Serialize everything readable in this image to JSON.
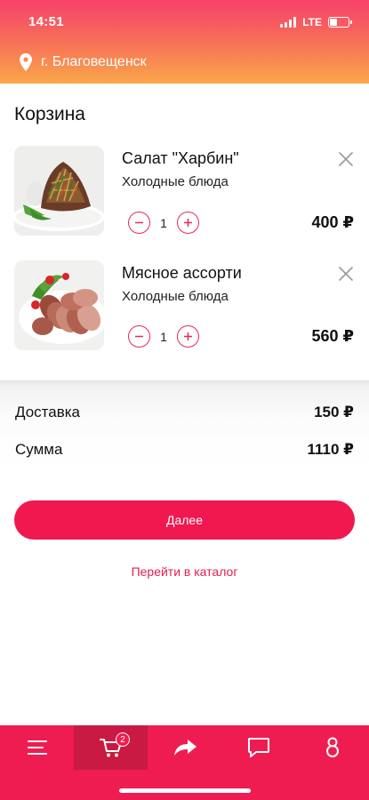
{
  "status_bar": {
    "time": "14:51",
    "network": "LTE"
  },
  "location": {
    "city": "г. Благовещенск"
  },
  "cart": {
    "title": "Корзина",
    "items": [
      {
        "name": "Салат \"Харбин\"",
        "category": "Холодные блюда",
        "quantity": "1",
        "price": "400 ₽",
        "photo": "salad-photo"
      },
      {
        "name": "Мясное ассорти",
        "category": "Холодные блюда",
        "quantity": "1",
        "price": "560 ₽",
        "photo": "meat-platter-photo"
      }
    ]
  },
  "summary": {
    "delivery_label": "Доставка",
    "delivery_value": "150 ₽",
    "total_label": "Сумма",
    "total_value": "1110 ₽"
  },
  "actions": {
    "next_label": "Далее",
    "catalog_link": "Перейти в каталог"
  },
  "bottom_nav": {
    "items": [
      "menu-icon",
      "cart-icon",
      "share-icon",
      "chat-icon",
      "profile-icon"
    ],
    "active": "cart-icon",
    "cart_badge": "2"
  },
  "colors": {
    "accent": "#f0184f",
    "header_gradient_start": "#f7416a",
    "header_gradient_end": "#f9a74a"
  }
}
